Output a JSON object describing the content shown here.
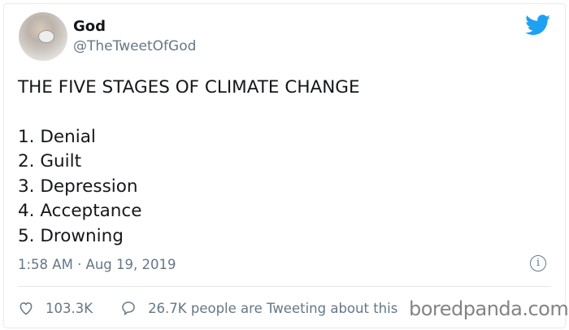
{
  "author": {
    "name": "God",
    "handle": "@TheTweetOfGod"
  },
  "tweet": {
    "title": "THE FIVE STAGES OF CLIMATE CHANGE",
    "items": [
      "1. Denial",
      "2. Guilt",
      "3. Depression",
      "4. Acceptance",
      "5. Drowning"
    ],
    "timestamp": "1:58 AM · Aug 19, 2019"
  },
  "stats": {
    "likes": "103.3K",
    "tweeting": "26.7K people are Tweeting about this"
  },
  "watermark": "boredpanda.com",
  "colors": {
    "brand": "#1da1f2",
    "muted": "#657786"
  }
}
